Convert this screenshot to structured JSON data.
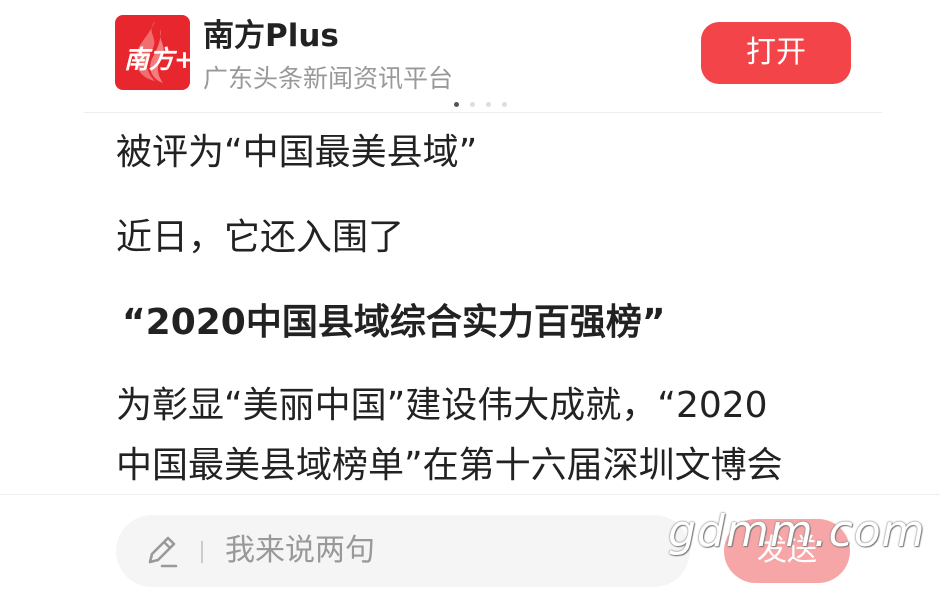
{
  "header": {
    "logo_text": "南方+",
    "app_name": "南方Plus",
    "subtitle": "广东头条新闻资讯平台",
    "open_label": "打开",
    "brand_color": "#e8262d",
    "button_color": "#f24449",
    "carousel_dots": 4,
    "carousel_active": 1
  },
  "article": {
    "paragraphs": [
      "被评为“中国最美县域”",
      "近日，它还入围了",
      "“2020中国县域综合实力百强榜”",
      "为彰显“美丽中国”建设伟大成就，“2020",
      "中国最美县域榜单”在第十六届深圳文博会"
    ]
  },
  "footer": {
    "comment_placeholder": "我来说两句",
    "send_label": "发送",
    "send_color": "#f7a6a7",
    "pen_icon": "pen-icon"
  },
  "watermark": {
    "text": "gdmm.com"
  }
}
